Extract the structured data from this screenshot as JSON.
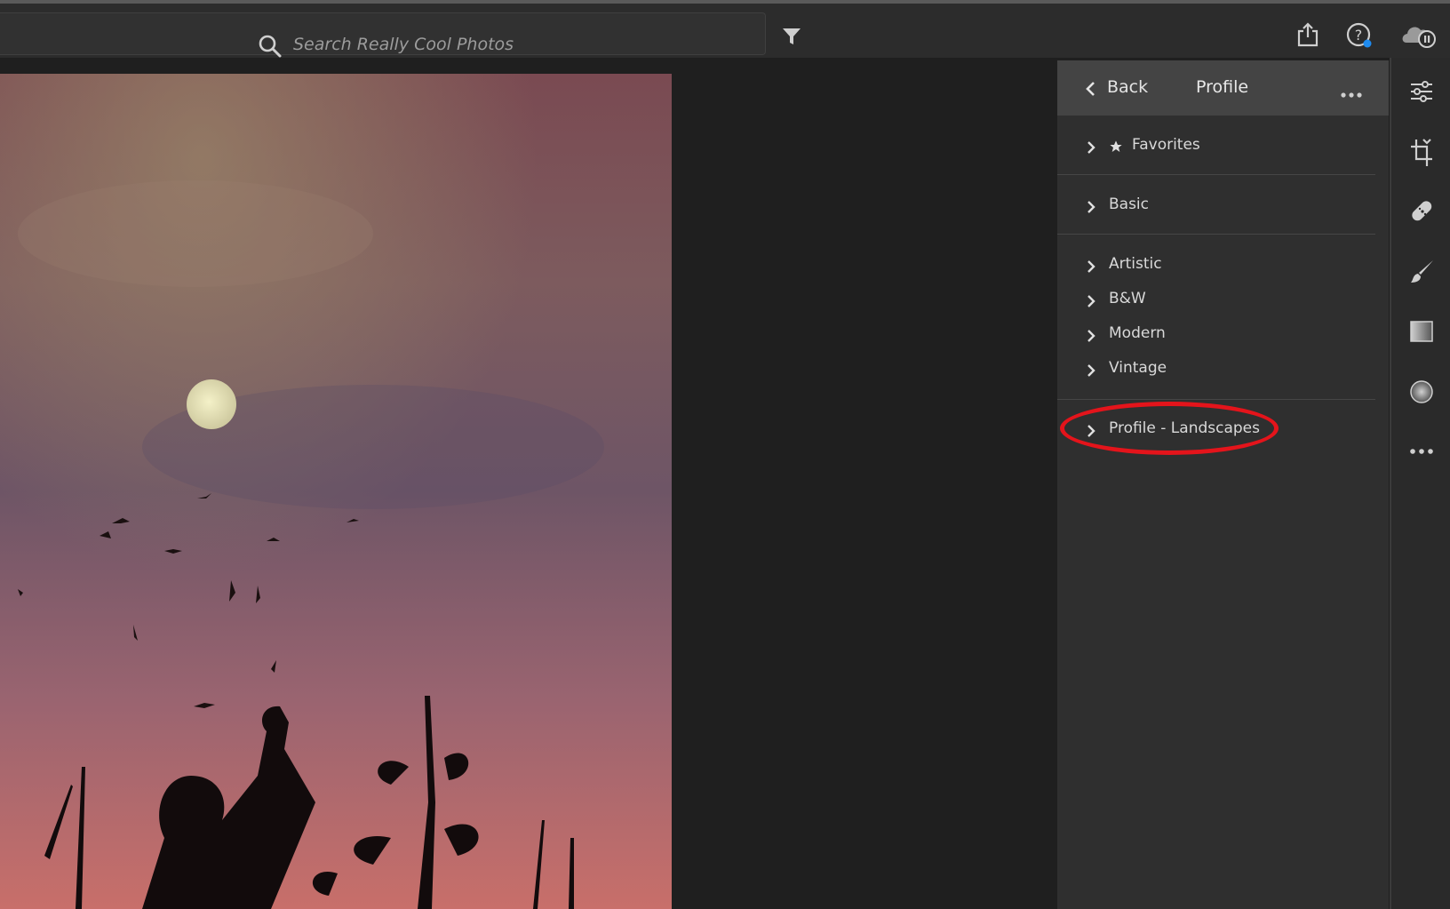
{
  "toolbar": {
    "search_placeholder": "Search Really Cool Photos",
    "icons": [
      "search-icon",
      "filter-icon",
      "share-icon",
      "help-icon",
      "cloud-sync-icon"
    ]
  },
  "panel": {
    "back_label": "Back",
    "title": "Profile",
    "groups": [
      {
        "items": [
          {
            "label": "Favorites",
            "icon": "star-icon"
          }
        ]
      },
      {
        "items": [
          {
            "label": "Basic"
          }
        ]
      },
      {
        "items": [
          {
            "label": "Artistic"
          },
          {
            "label": "B&W"
          },
          {
            "label": "Modern"
          },
          {
            "label": "Vintage"
          }
        ]
      },
      {
        "items": [
          {
            "label": "Profile - Landscapes",
            "highlighted": true
          }
        ]
      }
    ]
  },
  "tools": [
    "edit-sliders-icon",
    "crop-icon",
    "healing-icon",
    "brush-icon",
    "linear-gradient-icon",
    "radial-gradient-icon",
    "more-icon"
  ],
  "colors": {
    "highlight": "#e4141b",
    "panel_bg": "#2f2f2f",
    "header_bg": "#444444"
  }
}
